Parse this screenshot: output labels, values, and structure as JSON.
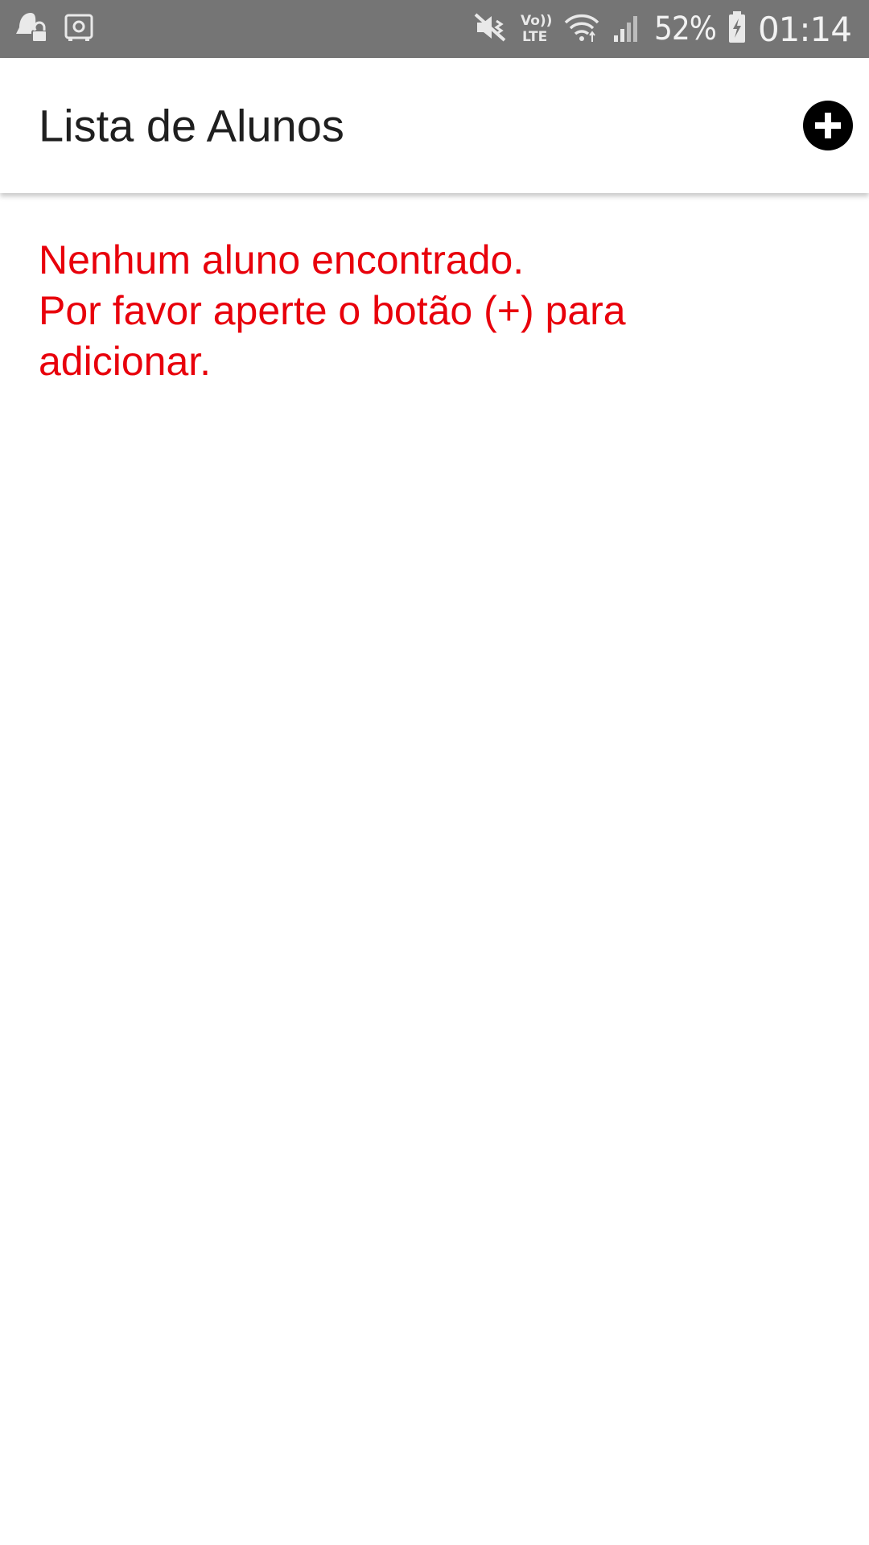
{
  "status_bar": {
    "left_icons": [
      "notification-lock-icon",
      "safe-icon"
    ],
    "right_icons": [
      "vibrate-mute-icon",
      "volte-lte-icon",
      "wifi-icon",
      "signal-icon",
      "battery-charging-icon"
    ],
    "volte_line1": "Vo))",
    "volte_line2": "LTE",
    "battery_percent": "52%",
    "time": "01:14"
  },
  "app_bar": {
    "title": "Lista de Alunos",
    "add_button_icon": "add-circle-icon"
  },
  "content": {
    "empty_line1": "Nenhum aluno encontrado.",
    "empty_line2": "Por favor aperte o botão (+) para",
    "empty_line3": "adicionar."
  },
  "colors": {
    "status_bar_bg": "#757575",
    "message_text": "#e8000b",
    "title_text": "#1f1f1f",
    "add_button_bg": "#000000"
  }
}
